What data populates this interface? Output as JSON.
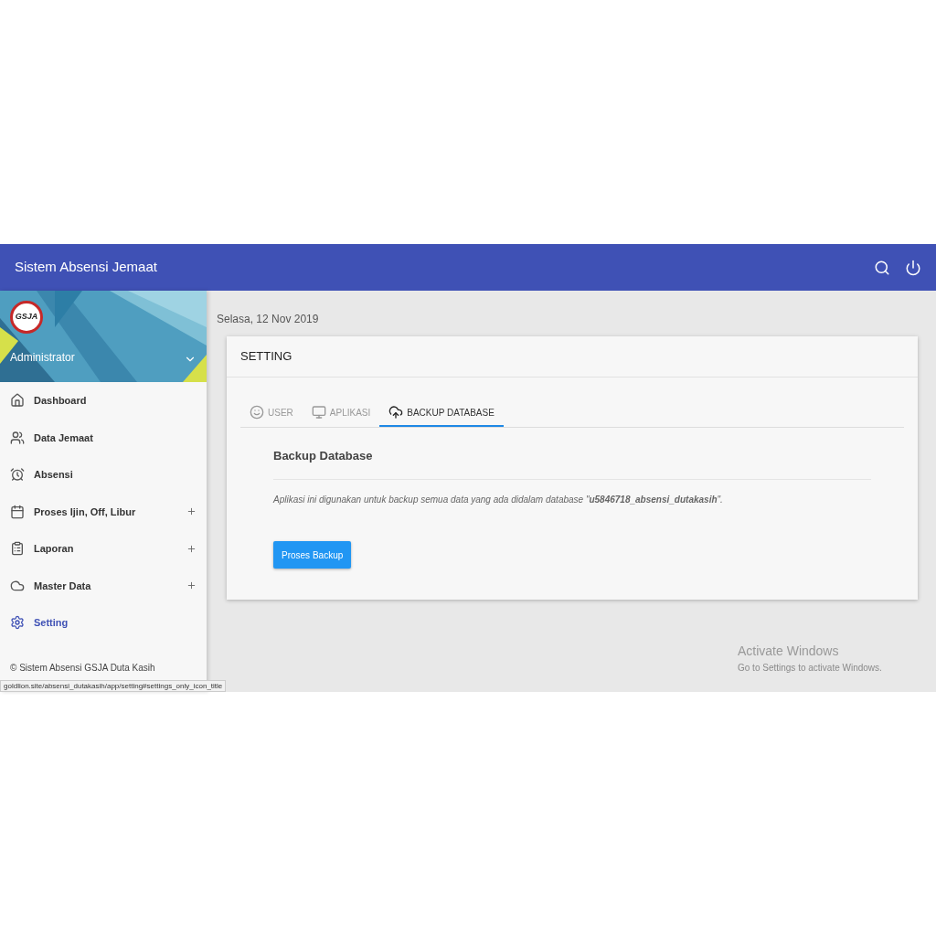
{
  "app_bar": {
    "title": "Sistem Absensi Jemaat"
  },
  "profile": {
    "logo_text": "GSJA",
    "name": "Administrator"
  },
  "sidebar": {
    "items": [
      {
        "label": "Dashboard",
        "expandable": false,
        "selected": false
      },
      {
        "label": "Data Jemaat",
        "expandable": false,
        "selected": false
      },
      {
        "label": "Absensi",
        "expandable": false,
        "selected": false
      },
      {
        "label": "Proses Ijin, Off, Libur",
        "expandable": true,
        "selected": false
      },
      {
        "label": "Laporan",
        "expandable": true,
        "selected": false
      },
      {
        "label": "Master Data",
        "expandable": true,
        "selected": false
      },
      {
        "label": "Setting",
        "expandable": false,
        "selected": true
      }
    ],
    "footer": "© Sistem Absensi GSJA Duta Kasih"
  },
  "date": "Selasa, 12 Nov 2019",
  "card": {
    "title": "SETTING",
    "tabs": [
      {
        "label": "USER",
        "selected": false
      },
      {
        "label": "APLIKASI",
        "selected": false
      },
      {
        "label": "BACKUP DATABASE",
        "selected": true
      }
    ],
    "section_title": "Backup Database",
    "description": "Aplikasi ini digunakan untuk backup semua data yang ada didalam database \"**u5846718_absensi_dutakasih**\".",
    "button": "Proses Backup"
  },
  "status_url": "goldlion.site/absensi_dutakasih/app/setting#settings_only_icon_title",
  "activation": {
    "title": "Activate Windows",
    "subtitle": "Go to Settings to activate Windows."
  }
}
